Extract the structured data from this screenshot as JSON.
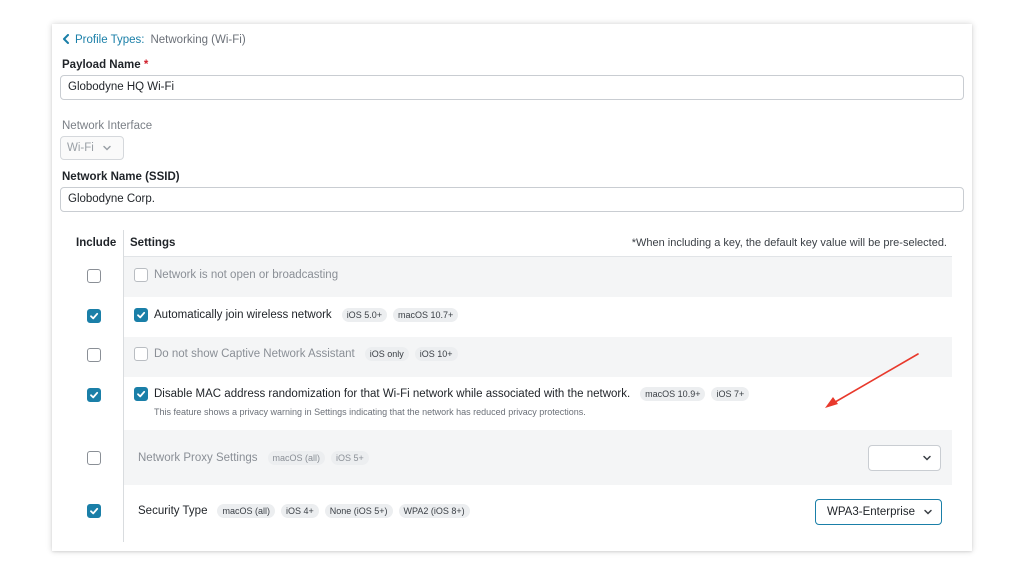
{
  "breadcrumb": {
    "back_label": "Profile Types:",
    "current": "Networking (Wi-Fi)"
  },
  "payload": {
    "label": "Payload Name",
    "required_mark": "*",
    "value": "Globodyne HQ Wi-Fi"
  },
  "interface": {
    "label": "Network Interface",
    "value": "Wi-Fi"
  },
  "ssid": {
    "label": "Network Name (SSID)",
    "value": "Globodyne Corp."
  },
  "table": {
    "include_header": "Include",
    "settings_header": "Settings",
    "note": "*When including a key, the default key value will be pre-selected.",
    "rows": [
      {
        "include": false,
        "label": "Network is not open or broadcasting",
        "tags": []
      },
      {
        "include": true,
        "label": "Automatically join wireless network",
        "tags": [
          "iOS 5.0+",
          "macOS 10.7+"
        ]
      },
      {
        "include": false,
        "label": "Do not show Captive Network Assistant",
        "tags": [
          "iOS only",
          "iOS 10+"
        ]
      },
      {
        "include": true,
        "label": "Disable MAC address randomization for that Wi-Fi network while associated with the network.",
        "tags": [
          "macOS 10.9+",
          "iOS 7+"
        ],
        "subnote": "This feature shows a privacy warning in Settings indicating that the network has reduced privacy protections."
      },
      {
        "include": false,
        "label": "Network Proxy Settings",
        "tags": [
          "macOS (all)",
          "iOS 5+"
        ],
        "select_value": ""
      },
      {
        "include": true,
        "label": "Security Type",
        "tags": [
          "macOS (all)",
          "iOS 4+",
          "None (iOS 5+)",
          "WPA2 (iOS 8+)"
        ],
        "select_value": "WPA3-Enterprise"
      }
    ]
  },
  "colors": {
    "accent": "#1a7fa8",
    "annotation_arrow": "#e8392c",
    "required": "#d0202c"
  },
  "icons": {
    "back": "chevron-left-icon",
    "dropdown": "chevron-down-icon",
    "checked": "checkmark-icon"
  }
}
